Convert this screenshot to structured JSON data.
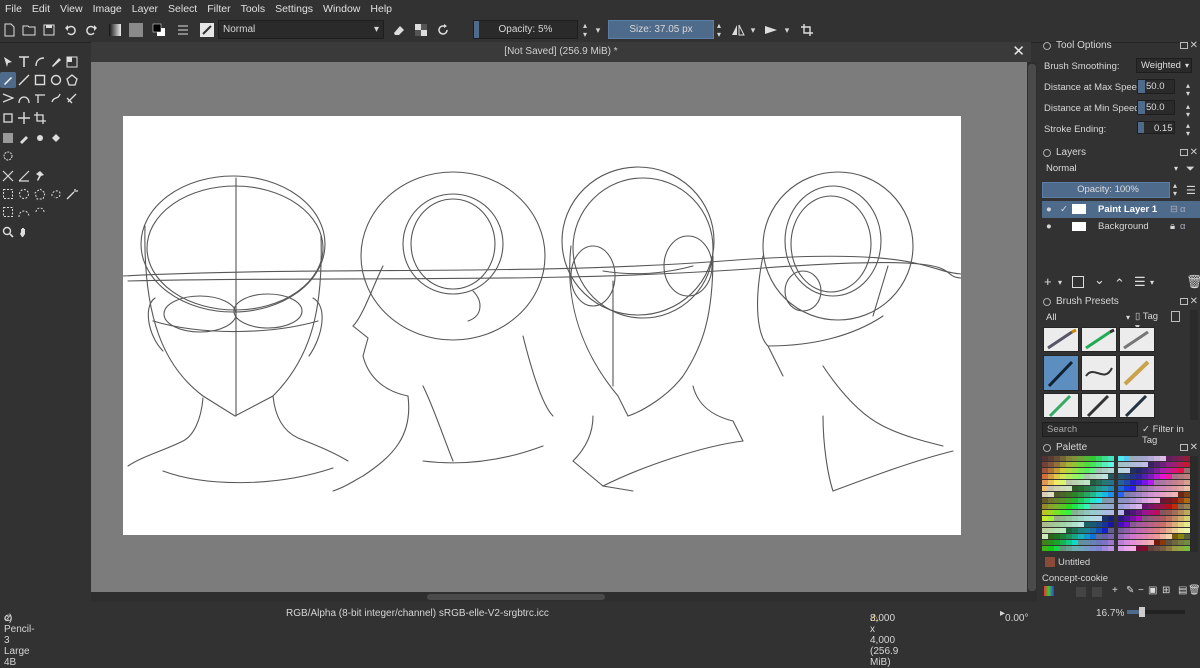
{
  "menu": [
    "File",
    "Edit",
    "View",
    "Image",
    "Layer",
    "Select",
    "Filter",
    "Tools",
    "Settings",
    "Window",
    "Help"
  ],
  "toolbar": {
    "blend_mode": "Normal",
    "opacity_label": "Opacity: 5%",
    "opacity_value": 0.05,
    "size_label": "Size: 37.05 px"
  },
  "document": {
    "title": "[Not Saved]  (256.9 MiB) *",
    "close_glyph": "✕"
  },
  "tool_options": {
    "title": "Tool Options",
    "brush_smoothing_label": "Brush Smoothing:",
    "brush_smoothing_value": "Weighted",
    "rows": [
      {
        "label": "Distance at Max Speed:",
        "value": "50.0"
      },
      {
        "label": "Distance at Min Speed:",
        "value": "50.0"
      },
      {
        "label": "Stroke Ending:",
        "value": "0.15"
      }
    ]
  },
  "layers": {
    "title": "Layers",
    "blend_mode": "Normal",
    "opacity_label": "Opacity: 100%",
    "items": [
      {
        "name": "Paint Layer 1",
        "selected": true
      },
      {
        "name": "Background",
        "selected": false
      }
    ]
  },
  "brush_presets": {
    "title": "Brush Presets",
    "filter_value": "All",
    "tag_label": "Tag",
    "search_placeholder": "Search",
    "filter_in_tag": "Filter in Tag"
  },
  "palette": {
    "title": "Palette",
    "current_name": "Untitled",
    "palette_name": "Concept-cookie",
    "current_color": "#8a4a38"
  },
  "status": {
    "brush": "c) Pencil-3 Large 4B",
    "color_info": "RGB/Alpha (8-bit integer/channel)  sRGB-elle-V2-srgbtrc.icc",
    "image_size": "8,000 x 4,000 (256.9 MiB)",
    "rotation": "0.00°",
    "zoom": "16.7%"
  },
  "colors": {
    "accent": "#4f6b8c",
    "panel": "#323232",
    "canvas_bg": "#7c7c7c"
  }
}
